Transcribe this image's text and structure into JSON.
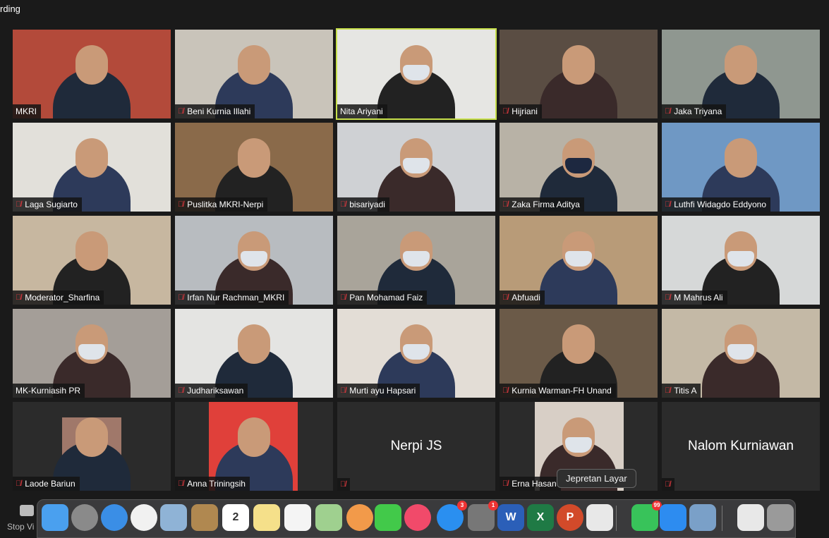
{
  "recording_label": "rding",
  "participants": [
    {
      "name": "MKRI",
      "muted": false,
      "bg": "#b34a3a"
    },
    {
      "name": "Beni Kurnia Illahi",
      "muted": true,
      "bg": "#c9c4ba"
    },
    {
      "name": "Nita Ariyani",
      "muted": false,
      "bg": "#e6e6e3",
      "active": true
    },
    {
      "name": "Hijriani",
      "muted": true,
      "bg": "#5a4d43"
    },
    {
      "name": "Jaka Triyana",
      "muted": true,
      "bg": "#8f9790"
    },
    {
      "name": "Laga Sugiarto",
      "muted": true,
      "bg": "#e2e0da"
    },
    {
      "name": "Puslitka MKRI-Nerpi",
      "muted": true,
      "bg": "#8a6a4a"
    },
    {
      "name": "bisariyadi",
      "muted": true,
      "bg": "#cfd1d4"
    },
    {
      "name": "Zaka Firma Aditya",
      "muted": true,
      "bg": "#b8b2a6"
    },
    {
      "name": "Luthfi Widagdo Eddyono",
      "muted": true,
      "bg": "#6f98c4"
    },
    {
      "name": "Moderator_Sharfina",
      "muted": true,
      "bg": "#c7b7a0"
    },
    {
      "name": "Irfan Nur Rachman_MKRI",
      "muted": true,
      "bg": "#b8bcc0"
    },
    {
      "name": "Pan Mohamad Faiz",
      "muted": true,
      "bg": "#a9a49a"
    },
    {
      "name": "Abfuadi",
      "muted": true,
      "bg": "#b89b78"
    },
    {
      "name": "M Mahrus Ali",
      "muted": true,
      "bg": "#d6d8d8"
    },
    {
      "name": "MK-Kurniasih PR",
      "muted": false,
      "bg": "#a49e98"
    },
    {
      "name": "Judhariksawan",
      "muted": true,
      "bg": "#e4e4e2"
    },
    {
      "name": "Murti ayu Hapsari",
      "muted": true,
      "bg": "#e3ddd6"
    },
    {
      "name": "Kurnia Warman-FH Unand",
      "muted": true,
      "bg": "#6b5a48"
    },
    {
      "name": "Titis A",
      "muted": true,
      "bg": "#c4b9a6"
    },
    {
      "name": "Laode Bariun",
      "muted": true,
      "bg": "#2b2b2b"
    },
    {
      "name": "Anna Triningsih",
      "muted": true,
      "bg": "#2b2b2b"
    },
    {
      "name": "Nerpi JS",
      "muted": true,
      "bg": "#2b2b2b",
      "no_video": true
    },
    {
      "name": "Erna Hasan",
      "muted": true,
      "bg": "#2b2b2b"
    },
    {
      "name": "Nalom Kurniawan",
      "muted": true,
      "bg": "#2b2b2b",
      "no_video": true
    }
  ],
  "tooltip": "Jepretan Layar",
  "stop_video_label": "Stop Vi",
  "dock": [
    {
      "icon": "finder-icon",
      "color": "#4aa0ef"
    },
    {
      "icon": "launchpad-icon",
      "color": "#8a8a8a"
    },
    {
      "icon": "safari-icon",
      "color": "#3a8ee6"
    },
    {
      "icon": "chrome-icon",
      "color": "#f1f1f1"
    },
    {
      "icon": "mail-icon",
      "color": "#8fb3d6"
    },
    {
      "icon": "contacts-icon",
      "color": "#b08850"
    },
    {
      "icon": "calendar-icon",
      "color": "#ffffff",
      "text": "2"
    },
    {
      "icon": "notes-icon",
      "color": "#f5e08a"
    },
    {
      "icon": "reminders-icon",
      "color": "#f4f4f4"
    },
    {
      "icon": "maps-icon",
      "color": "#9fd08f"
    },
    {
      "icon": "photos-icon",
      "color": "#f29a4a"
    },
    {
      "icon": "facetime-icon",
      "color": "#42c94a"
    },
    {
      "icon": "music-icon",
      "color": "#f14a6a"
    },
    {
      "icon": "app-store-icon",
      "color": "#2a8ff0",
      "badge": "3"
    },
    {
      "icon": "system-preferences-icon",
      "color": "#777777",
      "badge": "1"
    },
    {
      "icon": "word-icon",
      "color": "#2b5fb8",
      "text": "W"
    },
    {
      "icon": "excel-icon",
      "color": "#1f7a45",
      "text": "X"
    },
    {
      "icon": "powerpoint-icon",
      "color": "#d24a2a",
      "text": "P"
    },
    {
      "icon": "screenshot-icon",
      "color": "#e8e8e8"
    },
    {
      "icon": "whatsapp-icon",
      "color": "#38c35a",
      "badge": "99"
    },
    {
      "icon": "zoom-icon",
      "color": "#2d8cf0"
    },
    {
      "icon": "preview-icon",
      "color": "#7aa0c8"
    },
    {
      "icon": "document-icon",
      "color": "#e8e8e8"
    },
    {
      "icon": "trash-icon",
      "color": "#9a9a9a"
    }
  ]
}
